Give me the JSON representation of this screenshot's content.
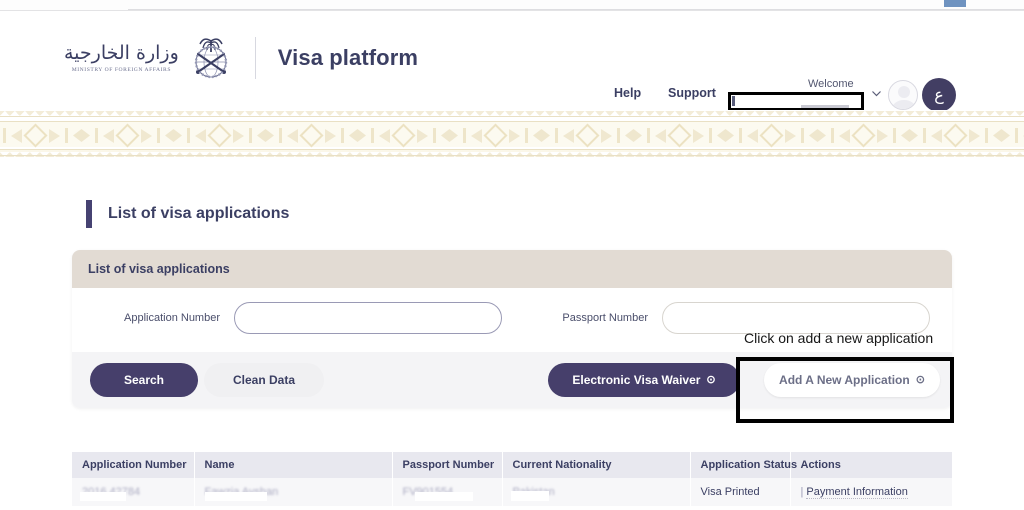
{
  "browser": {
    "accent_color": "#6f93c0"
  },
  "header": {
    "logo_arabic": "وزارة الخارجية",
    "logo_english": "MINISTRY OF FOREIGN AFFAIRS",
    "emblem_name": "saudi-emblem",
    "app_title": "Visa platform"
  },
  "topnav": {
    "help": "Help",
    "support": "Support",
    "welcome": "Welcome",
    "user_name_redacted": "",
    "lang_toggle": "ع",
    "chevron_icon": "chevron-down-icon",
    "avatar_icon": "user-avatar-icon"
  },
  "page": {
    "title": "List of visa applications"
  },
  "card": {
    "header": "List of visa applications",
    "fields": [
      {
        "label": "Application Number",
        "value": "",
        "placeholder": ""
      },
      {
        "label": "Passport Number",
        "value": "",
        "placeholder": ""
      }
    ],
    "buttons": {
      "search": "Search",
      "clean": "Clean Data",
      "evw": "Electronic Visa Waiver",
      "evw_icon": "⊙",
      "add": "Add A New Application",
      "add_icon": "⊙"
    }
  },
  "annotation": {
    "text": "Click on add a new application",
    "target": "add-a-new-application-button"
  },
  "table": {
    "columns": [
      "Application Number",
      "Name",
      "Passport Number",
      "Current Nationality",
      "Application Status",
      "Actions"
    ],
    "rows": [
      {
        "application_number": "2016 42784",
        "name": "Fawzia Ayshan",
        "passport_number": "FV901554",
        "current_nationality": "Pakistan",
        "application_status": "Visa Printed",
        "actions_separator": "|",
        "actions_link": "Payment Information"
      }
    ]
  },
  "colors": {
    "brand_purple": "#463f6b",
    "title_navy": "#3b3f63",
    "card_header_beige": "#e2dbd3",
    "table_header": "#e8e8ef",
    "ornament_gold": "#ece2c2"
  }
}
